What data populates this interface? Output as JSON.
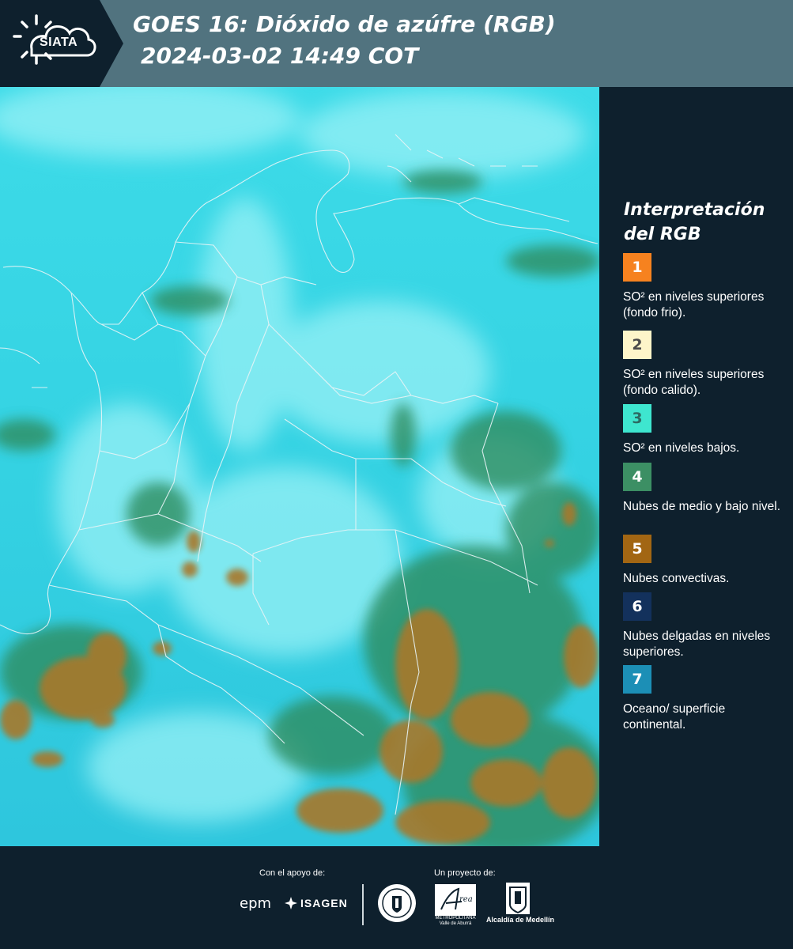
{
  "header": {
    "logo_text": "SIATA",
    "title_line1": "GOES 16: Dióxido de azúfre (RGB)",
    "title_line2": "2024-03-02 14:49 COT"
  },
  "legend": {
    "title": "Interpretación del RGB",
    "items": [
      {
        "number": "1",
        "color": "#f6821f",
        "text_color": "#ffffff",
        "text": "SO² en niveles superiores (fondo frio)."
      },
      {
        "number": "2",
        "color": "#fdf5c9",
        "text_color": "#4a4a4a",
        "text": "SO² en niveles superiores (fondo calido)."
      },
      {
        "number": "3",
        "color": "#3ee6cf",
        "text_color": "#2c6b63",
        "text": "SO² en niveles bajos."
      },
      {
        "number": "4",
        "color": "#3c8f64",
        "text_color": "#ffffff",
        "text": "Nubes de medio y bajo nivel."
      },
      {
        "number": "5",
        "color": "#a26613",
        "text_color": "#ffffff",
        "text": "Nubes convectivas."
      },
      {
        "number": "6",
        "color": "#13315c",
        "text_color": "#ffffff",
        "text": "Nubes delgadas en niveles superiores."
      },
      {
        "number": "7",
        "color": "#1c8fb6",
        "text_color": "#ffffff",
        "text": "Oceano/ superficie continental."
      }
    ]
  },
  "map": {
    "colors": {
      "ocean_cyan": "#2fd4e6",
      "pale_cyan": "#8ff3f7",
      "green": "#3f9c6a",
      "dark_green": "#2c6e49",
      "brown": "#a87a2a",
      "border": "#e8f4f6"
    }
  },
  "footer": {
    "support_label": "Con el apoyo de:",
    "project_label": "Un proyecto de:",
    "epm_text": "epm",
    "isagen_text": "ISAGEN",
    "area_caption": "METROPOLITANA Valle de Aburrá",
    "alcaldia_text": "Alcaldía de Medellín"
  }
}
